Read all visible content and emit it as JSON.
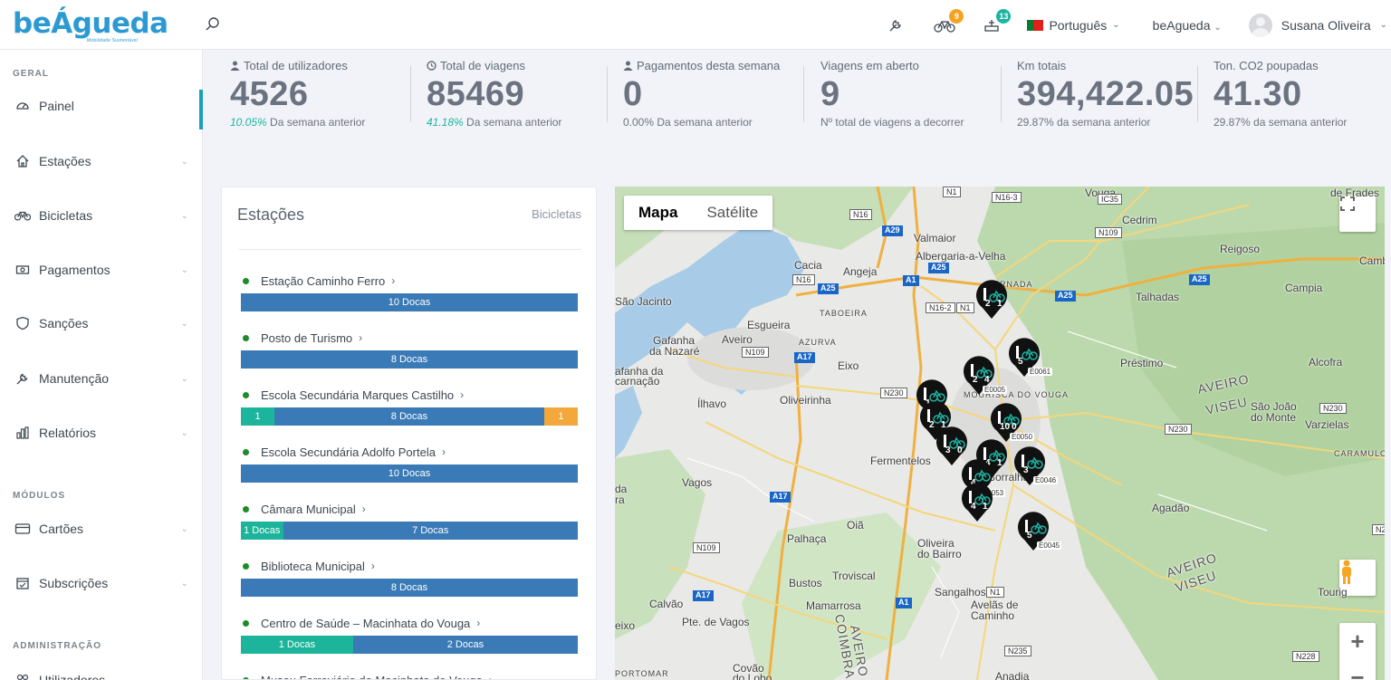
{
  "header": {
    "logo_text": "beÁgueda",
    "logo_subtitle": "Mobilidade Sustentável",
    "bike_badge": "9",
    "dock_badge": "13",
    "language": "Português",
    "organization": "beAgueda",
    "user_name": "Susana Oliveira"
  },
  "sidebar": {
    "section_geral": "GERAL",
    "section_modulos": "MÓDULOS",
    "section_admin": "ADMINISTRAÇÃO",
    "items": [
      {
        "label": "Painel",
        "icon": "dashboard-icon"
      },
      {
        "label": "Estações",
        "icon": "home-icon"
      },
      {
        "label": "Bicicletas",
        "icon": "bike-icon"
      },
      {
        "label": "Pagamentos",
        "icon": "payment-icon"
      },
      {
        "label": "Sanções",
        "icon": "shield-icon"
      },
      {
        "label": "Manutenção",
        "icon": "wrench-icon"
      },
      {
        "label": "Relatórios",
        "icon": "chart-icon"
      },
      {
        "label": "Cartões",
        "icon": "card-icon"
      },
      {
        "label": "Subscrições",
        "icon": "calendar-check-icon"
      },
      {
        "label": "Utilizadores",
        "icon": "users-icon"
      }
    ]
  },
  "stats": [
    {
      "label": "Total de utilizadores",
      "icon": "user-icon",
      "value": "4526",
      "pct": "10.05%",
      "sub": " Da semana anterior"
    },
    {
      "label": "Total de viagens",
      "icon": "clock-icon",
      "value": "85469",
      "pct": "41.18%",
      "sub": " Da semana anterior"
    },
    {
      "label": "Pagamentos desta semana",
      "icon": "user-icon",
      "value": "0",
      "pct": "",
      "sub": "0.00% Da semana anterior"
    },
    {
      "label": "Viagens em aberto",
      "icon": "",
      "value": "9",
      "pct": "",
      "sub": "Nº total de viagens a decorrer"
    },
    {
      "label": "Km totais",
      "icon": "",
      "value": "394,422.05",
      "pct": "",
      "sub": "29.87% da semana anterior"
    },
    {
      "label": "Ton. CO2 poupadas",
      "icon": "",
      "value": "41.30",
      "pct": "",
      "sub": "29.87% da semana anterior"
    }
  ],
  "stations_panel": {
    "title": "Estações",
    "link": "Bicicletas",
    "stations": [
      {
        "name": "Estação Caminho Ferro",
        "segments": [
          {
            "type": "blue",
            "label": "10 Docas",
            "share": 1
          }
        ]
      },
      {
        "name": "Posto de Turismo",
        "segments": [
          {
            "type": "blue",
            "label": "8 Docas",
            "share": 1
          }
        ]
      },
      {
        "name": "Escola Secundária Marques Castilho",
        "segments": [
          {
            "type": "teal",
            "label": "1",
            "share": 0.1
          },
          {
            "type": "blue",
            "label": "8 Docas",
            "share": 0.8
          },
          {
            "type": "orange",
            "label": "1",
            "share": 0.1
          }
        ]
      },
      {
        "name": "Escola Secundária Adolfo Portela",
        "segments": [
          {
            "type": "blue",
            "label": "10 Docas",
            "share": 1
          }
        ]
      },
      {
        "name": "Câmara Municipal",
        "segments": [
          {
            "type": "teal",
            "label": "1 Docas",
            "share": 0.125
          },
          {
            "type": "blue",
            "label": "7 Docas",
            "share": 0.875
          }
        ]
      },
      {
        "name": "Biblioteca Municipal",
        "segments": [
          {
            "type": "blue",
            "label": "8 Docas",
            "share": 1
          }
        ]
      },
      {
        "name": "Centro de Saúde – Macinhata do Vouga",
        "segments": [
          {
            "type": "teal",
            "label": "1 Docas",
            "share": 0.333
          },
          {
            "type": "blue",
            "label": "2 Docas",
            "share": 0.667
          }
        ]
      },
      {
        "name": "Museu Ferroviário de Macinhata do Vouga",
        "segments": [
          {
            "type": "blue",
            "label": "",
            "share": 1
          }
        ]
      }
    ]
  },
  "map": {
    "type_map": "Mapa",
    "type_satellite": "Satélite",
    "places": [
      {
        "name": "Valmaior"
      },
      {
        "name": "Albergaria-a-Velha"
      },
      {
        "name": "Cedrim"
      },
      {
        "name": "Reigoso"
      },
      {
        "name": "Campia"
      },
      {
        "name": "Talhadas"
      },
      {
        "name": "Cacia"
      },
      {
        "name": "Angeja"
      },
      {
        "name": "São Jacinto"
      },
      {
        "name": "Esgueira"
      },
      {
        "name": "Gafanha"
      },
      {
        "name": "da Nazaré"
      },
      {
        "name": "Aveiro"
      },
      {
        "name": "Eixo"
      },
      {
        "name": "afanha da"
      },
      {
        "name": "carnação"
      },
      {
        "name": "Ílhavo"
      },
      {
        "name": "Oliveirinha"
      },
      {
        "name": "Préstimo"
      },
      {
        "name": "Alcofra"
      },
      {
        "name": "São João"
      },
      {
        "name": "do Monte"
      },
      {
        "name": "Varzielas"
      },
      {
        "name": "Vagos"
      },
      {
        "name": "Agadão"
      },
      {
        "name": "Oiã"
      },
      {
        "name": "Palhaça"
      },
      {
        "name": "Oliveira"
      },
      {
        "name": "do Bairro"
      },
      {
        "name": "Bustos"
      },
      {
        "name": "Troviscal"
      },
      {
        "name": "Calvão"
      },
      {
        "name": "Pte. de Vagos"
      },
      {
        "name": "Mamarrosa"
      },
      {
        "name": "Sangalhos"
      },
      {
        "name": "Avelãs de"
      },
      {
        "name": "Caminho"
      },
      {
        "name": "Covão"
      },
      {
        "name": "do Lobo"
      },
      {
        "name": "Anadia"
      },
      {
        "name": "Fermentelos"
      },
      {
        "name": "Borralha"
      },
      {
        "name": "Tourig"
      },
      {
        "name": "Camb"
      },
      {
        "name": "de Frades"
      },
      {
        "name": "PORTOMAR"
      },
      {
        "name": "eixo"
      },
      {
        "name": "da"
      },
      {
        "name": "ra"
      },
      {
        "name": "Vouga"
      },
      {
        "name": "TABOEIRA"
      },
      {
        "name": "AZURVA"
      },
      {
        "name": "CARAMULO"
      },
      {
        "name": "SERNADA"
      },
      {
        "name": "MOURISCA DO VOUGA"
      }
    ],
    "region_labels": [
      "AVEIRO",
      "VISEU",
      "AVEIRO",
      "VISEU",
      "COIMBRA",
      "AVEIRO"
    ],
    "roads": [
      "N1",
      "N16-3",
      "IC35",
      "N16",
      "N109",
      "A29",
      "A25",
      "A1",
      "N16",
      "A25",
      "N16-2",
      "N1",
      "A25",
      "A25",
      "A17",
      "N109",
      "N230",
      "N230",
      "N230",
      "A17",
      "N109",
      "A17",
      "A1",
      "N1",
      "N235",
      "N228",
      "N22"
    ],
    "markers": [
      {
        "n1": "2",
        "n2": "1",
        "code": ""
      },
      {
        "n1": "5",
        "n2": "",
        "code": "E0061"
      },
      {
        "n1": "2",
        "n2": "4",
        "code": "E0005"
      },
      {
        "n1": "1",
        "n2": "",
        "code": ""
      },
      {
        "n1": "2",
        "n2": "1",
        "code": ""
      },
      {
        "n1": "10",
        "n2": "0",
        "code": "E0050"
      },
      {
        "n1": "3",
        "n2": "0",
        "code": ""
      },
      {
        "n1": "4",
        "n2": "1",
        "code": ""
      },
      {
        "n1": "4",
        "n2": "",
        "code": "E0053"
      },
      {
        "n1": "3",
        "n2": "",
        "code": "E0046"
      },
      {
        "n1": "4",
        "n2": "1",
        "code": ""
      },
      {
        "n1": "5",
        "n2": "",
        "code": "E0045"
      }
    ]
  }
}
